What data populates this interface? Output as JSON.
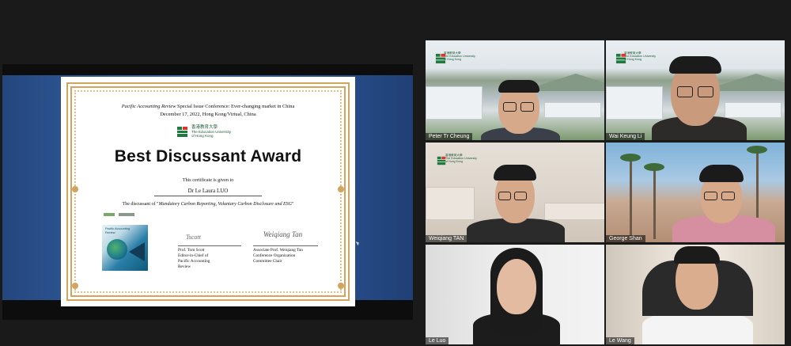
{
  "certificate": {
    "conference_journal": "Pacific Accounting Review",
    "conference_title": " Special Issue Conference: Ever-changing market in China",
    "date_location": "December 17, 2022, Hong Kong/Virtual, China",
    "univ_logo_zh": "香港教育大學",
    "univ_logo_en1": "The Education University",
    "univ_logo_en2": "of Hong Kong",
    "award_title": "Best Discussant Award",
    "given_text": "This certificate is given to",
    "recipient": "Dr Le Laura LUO",
    "discussant_prefix": "The discussant of \"",
    "paper_title": "Mandatory Carbon Reporting, Voluntary Carbon Disclosure and ESG",
    "discussant_suffix": "\"",
    "journal_cover_title1": "Pacific Accounting",
    "journal_cover_title2": "Review",
    "signature1_scrawl": "Tscott",
    "signature2_scrawl": "Weiqiang Tan",
    "signatory1": {
      "name": "Prof. Tom Scott",
      "role1": "Editor-in-Chief of",
      "role2": "Pacific Accounting",
      "role3": "Review"
    },
    "signatory2": {
      "name": "Associate Prof. Weiqiang Tan",
      "role1": "Conference Organization",
      "role2": "Committee Chair"
    }
  },
  "participants": [
    {
      "name": "Peter Tr Cheung"
    },
    {
      "name": "Wai Keung Li"
    },
    {
      "name": "Weiqiang TAN"
    },
    {
      "name": "George Shan"
    },
    {
      "name": "Le Luo"
    },
    {
      "name": "Le Wang"
    }
  ],
  "colors": {
    "background": "#1a1a1a",
    "border_gold": "#d2a45e",
    "share_blue": "#3b6cb0"
  }
}
